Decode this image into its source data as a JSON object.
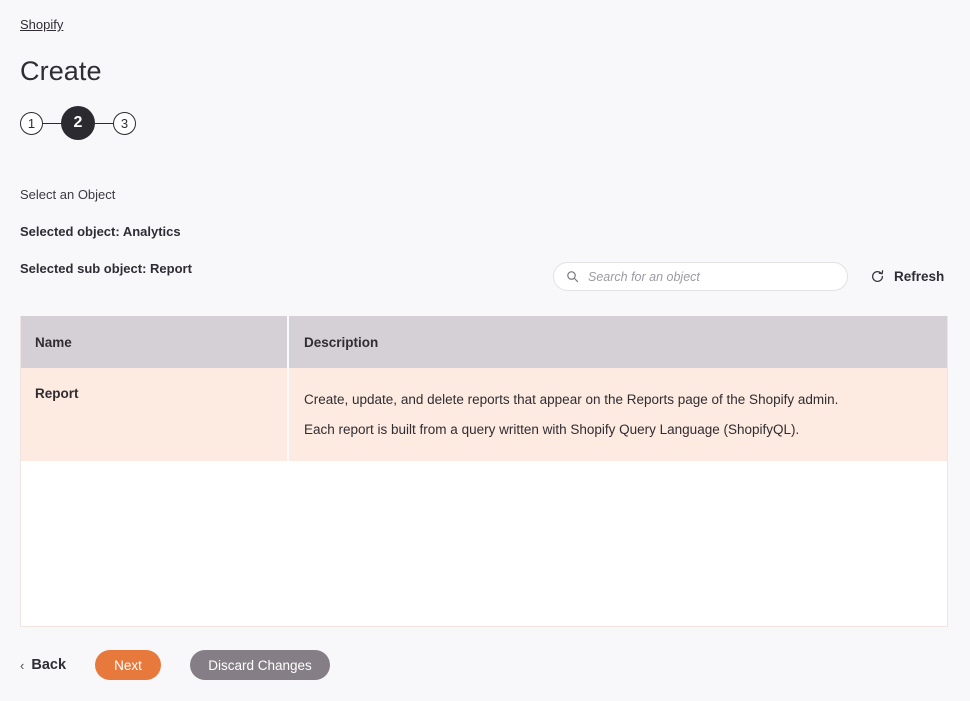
{
  "breadcrumb": {
    "label": "Shopify"
  },
  "header": {
    "title": "Create"
  },
  "stepper": {
    "steps": [
      {
        "label": "1",
        "state": "inactive"
      },
      {
        "label": "2",
        "state": "active"
      },
      {
        "label": "3",
        "state": "inactive"
      }
    ]
  },
  "form": {
    "select_label": "Select an Object",
    "selected_object": "Selected object: Analytics",
    "selected_sub_object": "Selected sub object: Report"
  },
  "search": {
    "placeholder": "Search for an object",
    "value": "",
    "icon": "search-icon"
  },
  "refresh": {
    "label": "Refresh",
    "icon": "refresh-icon"
  },
  "table": {
    "columns": [
      {
        "key": "name",
        "label": "Name"
      },
      {
        "key": "description",
        "label": "Description"
      }
    ],
    "rows": [
      {
        "name": "Report",
        "description_lines": [
          "Create, update, and delete reports that appear on the Reports page of the Shopify admin.",
          "Each report is built from a query written with Shopify Query Language (ShopifyQL)."
        ],
        "selected": true
      }
    ]
  },
  "actions": {
    "back_label": "Back",
    "back_icon": "chevron-left-icon",
    "next_label": "Next",
    "discard_label": "Discard Changes"
  },
  "colors": {
    "page_background": "#f8f8fa",
    "accent_orange": "#e8793c",
    "discard_gray": "#857e86",
    "table_header": "#d5d0d6",
    "row_selected": "#fdeae0",
    "step_active": "#2b2a30",
    "text": "#2f2d33"
  }
}
